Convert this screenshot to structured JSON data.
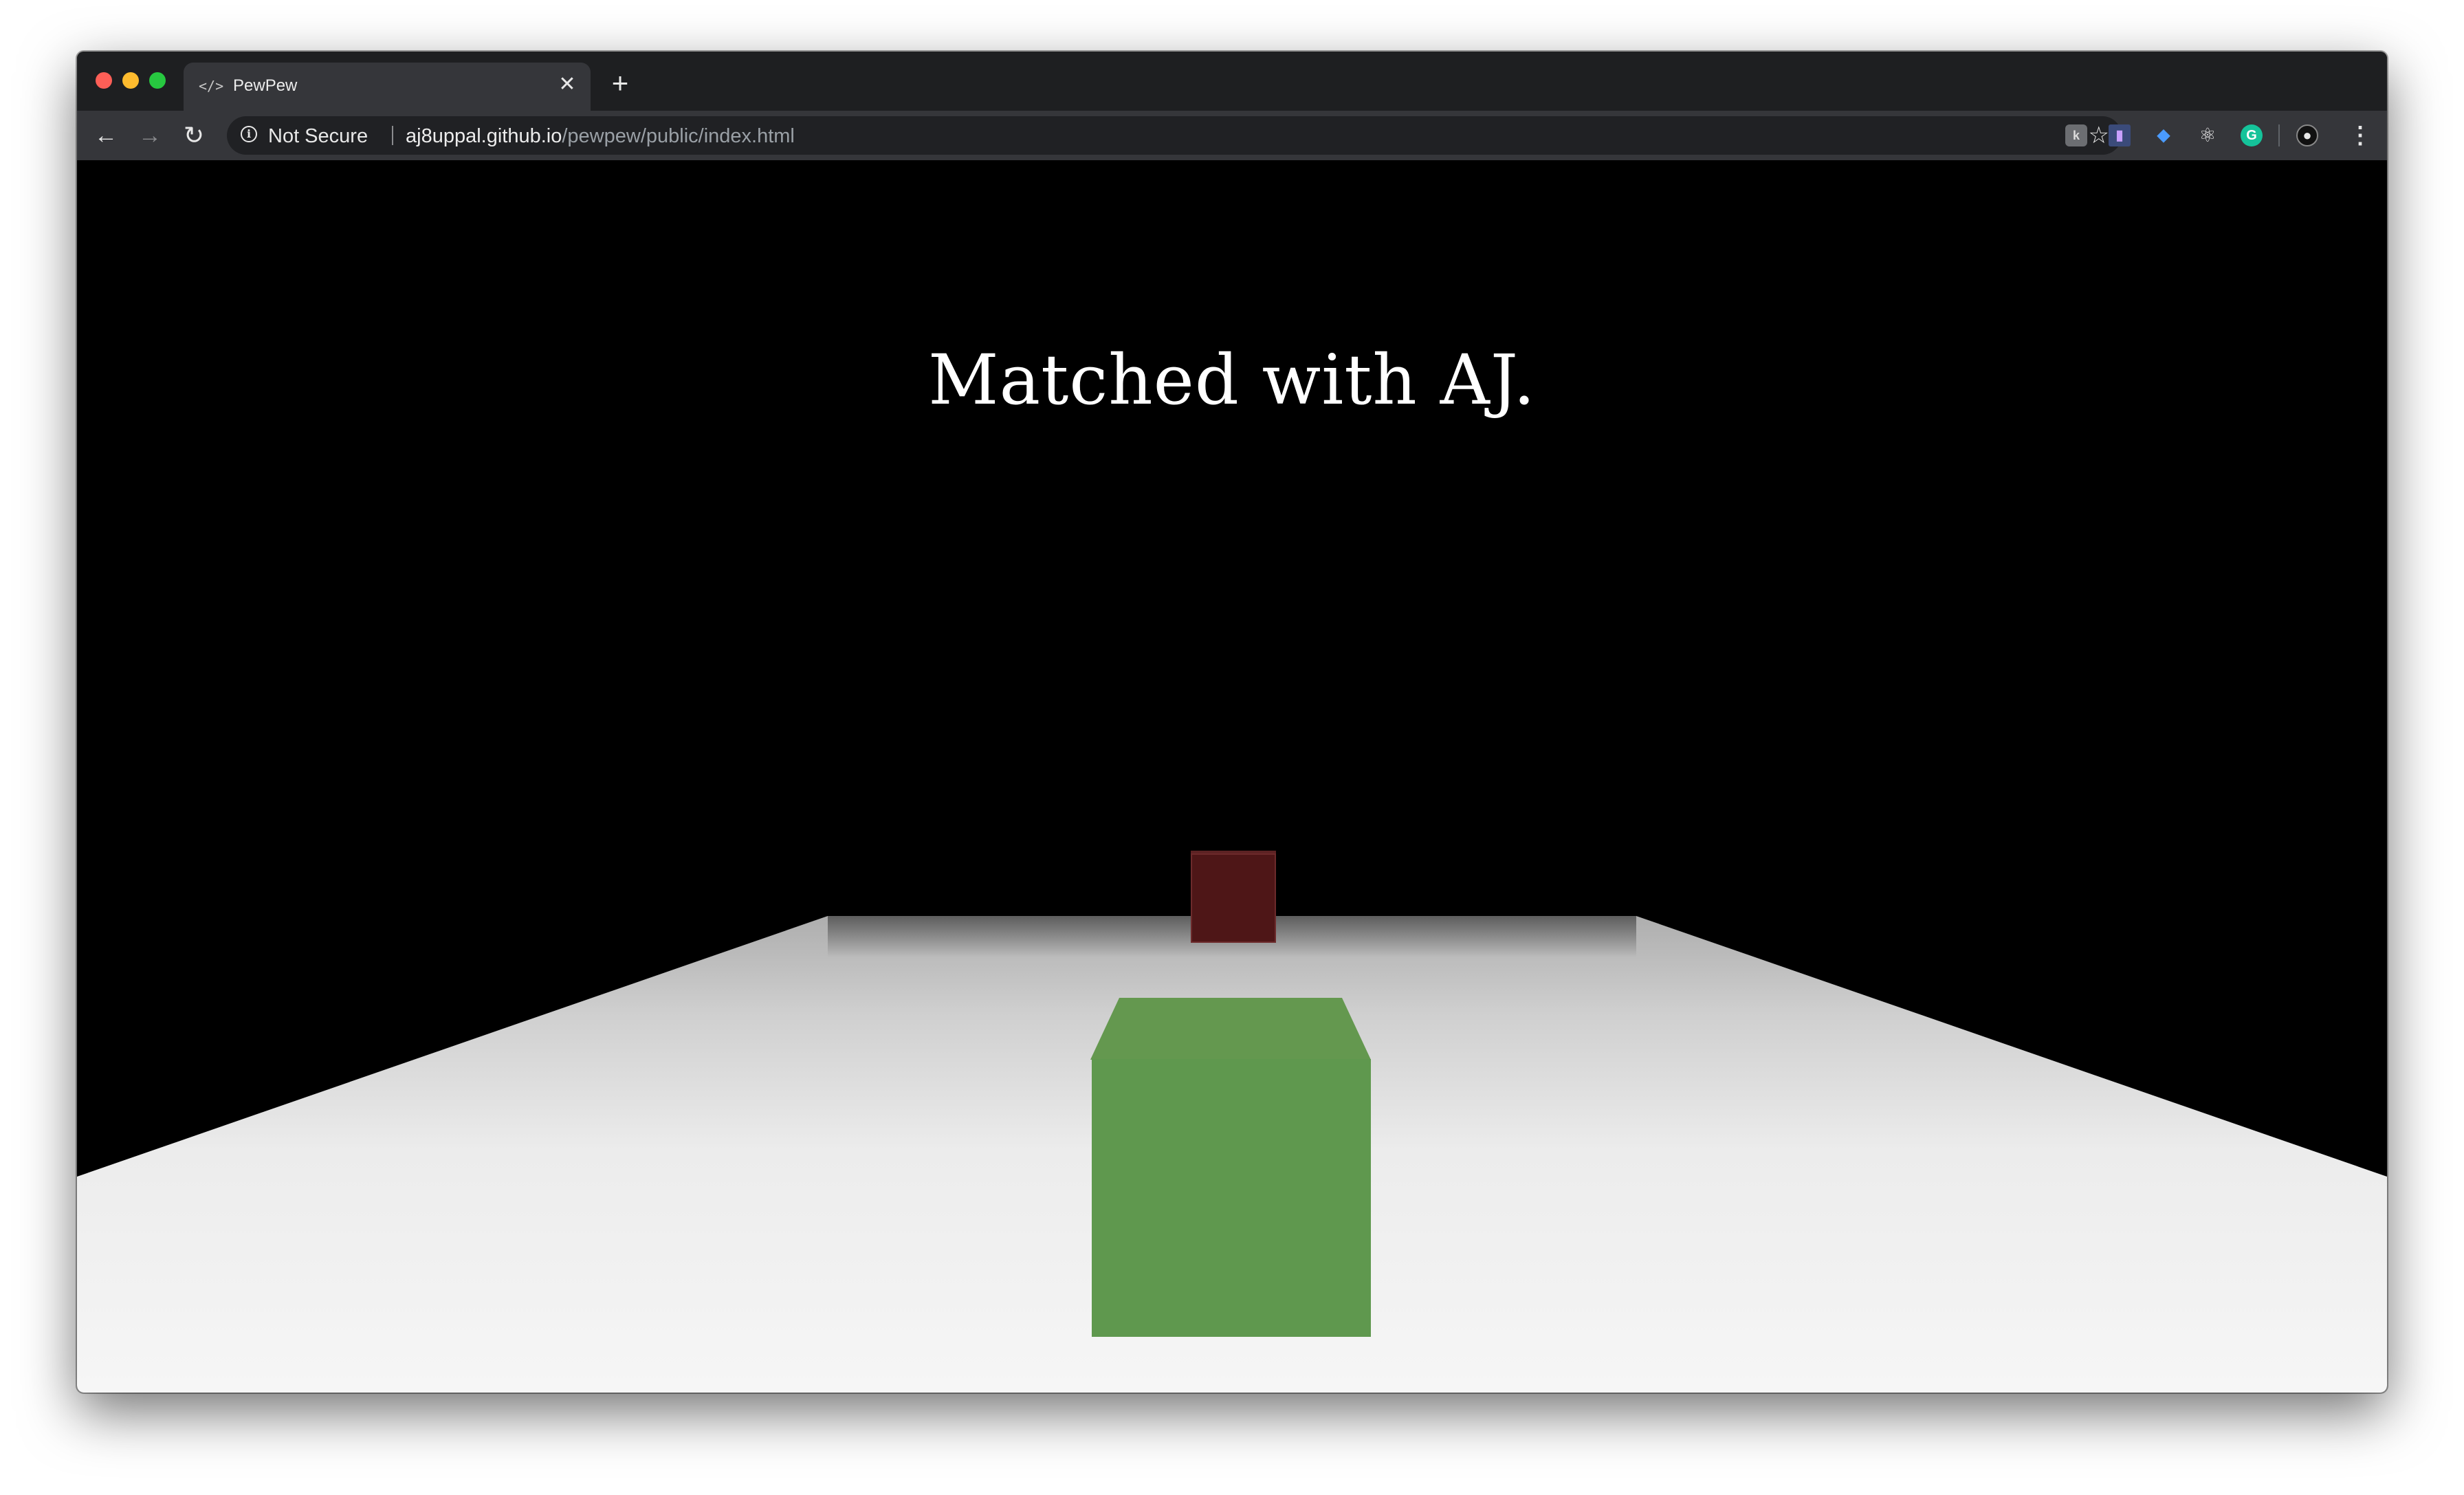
{
  "browser": {
    "tab": {
      "icon": "</>",
      "title": "PewPew",
      "close_glyph": "✕"
    },
    "new_tab_glyph": "+",
    "toolbar": {
      "back_glyph": "←",
      "forward_glyph": "→",
      "reload_glyph": "↻",
      "security_label": "Not Secure",
      "url_host": "aj8uppal.github.io",
      "url_path": "/pewpew/public/index.html",
      "bookmark_glyph": "☆",
      "menu_glyph": "⋮"
    },
    "extensions": [
      {
        "name": "extension-1-icon",
        "glyph": "k"
      },
      {
        "name": "extension-2-icon",
        "glyph": "▮"
      },
      {
        "name": "shield-extension-icon",
        "glyph": "◆"
      },
      {
        "name": "react-devtools-icon",
        "glyph": "⚛"
      },
      {
        "name": "grammarly-icon",
        "glyph": "G"
      },
      {
        "name": "profile-avatar-icon",
        "glyph": "●"
      }
    ]
  },
  "game": {
    "status_message": "Matched with AJ.",
    "colors": {
      "player_cube": "#5f984e",
      "enemy_cube": "#4e1617",
      "floor": "#f6f6f6",
      "background": "#000000"
    }
  }
}
